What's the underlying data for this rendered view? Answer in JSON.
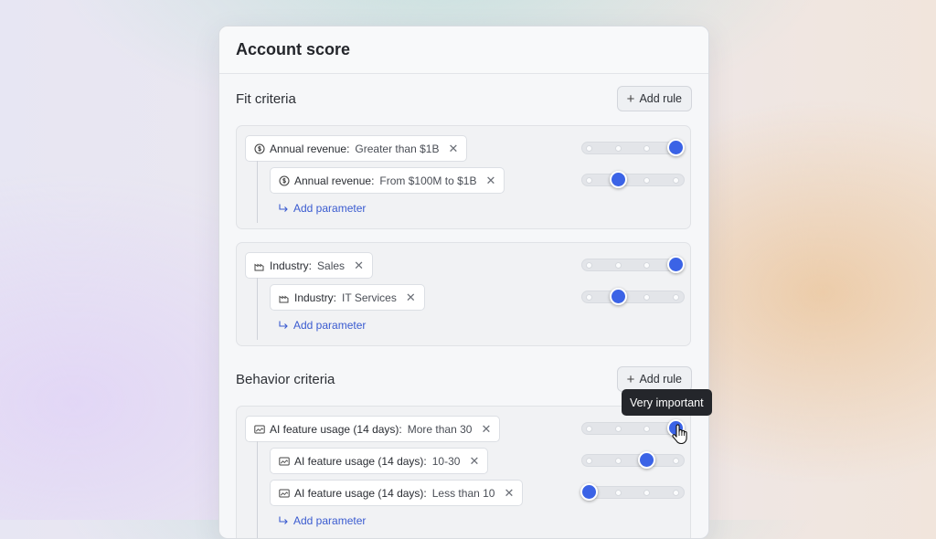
{
  "card": {
    "title": "Account score"
  },
  "fit": {
    "title": "Fit criteria",
    "add_rule": "Add rule",
    "groups": [
      {
        "icon": "dollar-circle-icon",
        "main": {
          "key": "Annual revenue:",
          "value": "Greater than $1B",
          "level": 3
        },
        "children": [
          {
            "key": "Annual revenue:",
            "value": "From $100M to $1B",
            "level": 1
          }
        ],
        "add_param": "Add parameter"
      },
      {
        "icon": "industry-icon",
        "main": {
          "key": "Industry:",
          "value": "Sales",
          "level": 3
        },
        "children": [
          {
            "key": "Industry:",
            "value": "IT Services",
            "level": 1
          }
        ],
        "add_param": "Add parameter"
      }
    ]
  },
  "behavior": {
    "title": "Behavior criteria",
    "add_rule": "Add rule",
    "groups": [
      {
        "icon": "chart-image-icon",
        "main": {
          "key": "AI feature usage (14 days):",
          "value": "More than 30",
          "level": 3
        },
        "children": [
          {
            "key": "AI feature usage (14 days):",
            "value": "10-30",
            "level": 2
          },
          {
            "key": "AI feature usage (14 days):",
            "value": "Less than 10",
            "level": 0
          }
        ],
        "add_param": "Add parameter"
      }
    ]
  },
  "tooltip": "Very important",
  "slider_levels": 4,
  "colors": {
    "accent": "#3b63e6",
    "link": "#3a5bd0",
    "tooltip_bg": "#24262b"
  }
}
